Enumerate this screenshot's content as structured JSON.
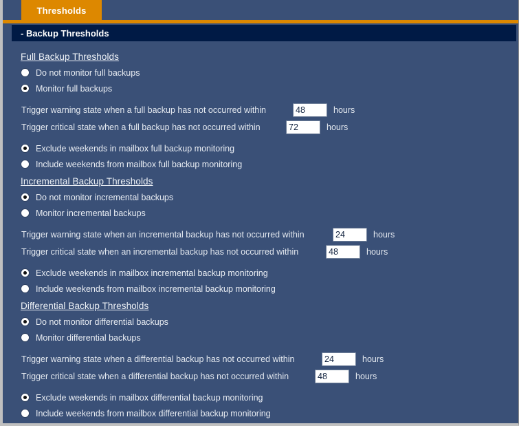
{
  "window": {
    "tab_label": "Thresholds",
    "section_header": "- Backup Thresholds"
  },
  "colors": {
    "accent_orange": "#dd8800",
    "panel_blue": "#3a5077",
    "header_navy": "#001a45",
    "text": "#e9edf3",
    "input_bg": "#ffffff"
  },
  "sections": [
    {
      "title": "Full Backup Thresholds",
      "monitor_options": [
        {
          "label": "Do not monitor full backups",
          "checked": false
        },
        {
          "label": "Monitor full backups",
          "checked": true
        }
      ],
      "triggers": [
        {
          "text": "Trigger warning state when a full backup has not occurred within",
          "value": "48",
          "unit": "hours",
          "indent": 395
        },
        {
          "text": "Trigger critical state when a full backup has not occurred within",
          "value": "72",
          "unit": "hours",
          "indent": 385
        }
      ],
      "weekend_options": [
        {
          "label": "Exclude weekends in mailbox full backup monitoring",
          "checked": true
        },
        {
          "label": "Include weekends from mailbox full backup monitoring",
          "checked": false
        }
      ]
    },
    {
      "title": "Incremental Backup Thresholds",
      "monitor_options": [
        {
          "label": "Do not monitor incremental backups",
          "checked": true
        },
        {
          "label": "Monitor incremental backups",
          "checked": false
        }
      ],
      "triggers": [
        {
          "text": "Trigger warning state when an incremental backup has not occurred within",
          "value": "24",
          "unit": "hours",
          "indent": 453
        },
        {
          "text": "Trigger critical state when an incremental backup has not occurred within",
          "value": "48",
          "unit": "hours",
          "indent": 443
        }
      ],
      "weekend_options": [
        {
          "label": "Exclude weekends in mailbox incremental backup monitoring",
          "checked": true
        },
        {
          "label": "Include weekends from mailbox incremental backup monitoring",
          "checked": false
        }
      ]
    },
    {
      "title": "Differential Backup Thresholds",
      "monitor_options": [
        {
          "label": "Do not monitor differential backups",
          "checked": true
        },
        {
          "label": "Monitor differential backups",
          "checked": false
        }
      ],
      "triggers": [
        {
          "text": "Trigger warning state when a differential backup has not occurred within",
          "value": "24",
          "unit": "hours",
          "indent": 437
        },
        {
          "text": "Trigger critical state when a differential backup has not occurred within",
          "value": "48",
          "unit": "hours",
          "indent": 427
        }
      ],
      "weekend_options": [
        {
          "label": "Exclude weekends in mailbox differential backup monitoring",
          "checked": true
        },
        {
          "label": "Include weekends from mailbox differential backup monitoring",
          "checked": false
        }
      ]
    }
  ]
}
